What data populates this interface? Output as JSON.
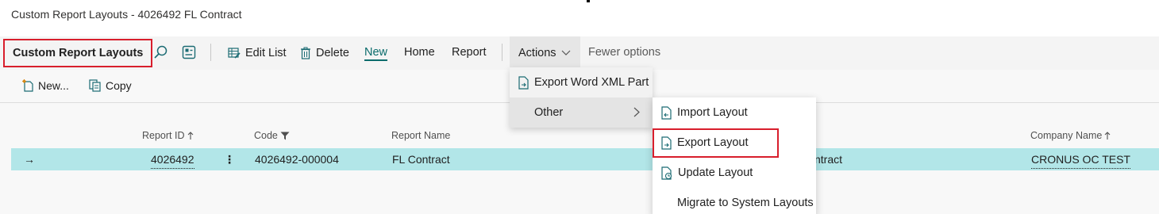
{
  "window": {
    "title": "Custom Report Layouts - 4026492 FL Contract"
  },
  "actionbar": {
    "page_caption": "Custom Report Layouts",
    "edit_list": "Edit List",
    "delete": "Delete",
    "new": "New",
    "home": "Home",
    "report": "Report",
    "actions": "Actions",
    "fewer_options": "Fewer options"
  },
  "subbar": {
    "new": "New...",
    "copy": "Copy"
  },
  "columns": {
    "report_id": "Report ID",
    "code": "Code",
    "report_name": "Report Name",
    "company_name": "Company Name"
  },
  "row": {
    "arrow": "→",
    "report_id": "4026492",
    "menu": "⋮",
    "code": "4026492-000004",
    "report_name": "FL Contract",
    "description_fragment": "ntract",
    "company_name": "CRONUS OC TEST"
  },
  "actions_menu": {
    "export_word_xml_part": "Export Word XML Part",
    "other": "Other"
  },
  "other_menu": {
    "import_layout": "Import Layout",
    "export_layout": "Export Layout",
    "update_layout": "Update Layout",
    "migrate": "Migrate to System Layouts"
  },
  "colors": {
    "accent": "#0a6b6b",
    "selection": "#b2e6e8",
    "highlight_box": "#d81e2c"
  }
}
